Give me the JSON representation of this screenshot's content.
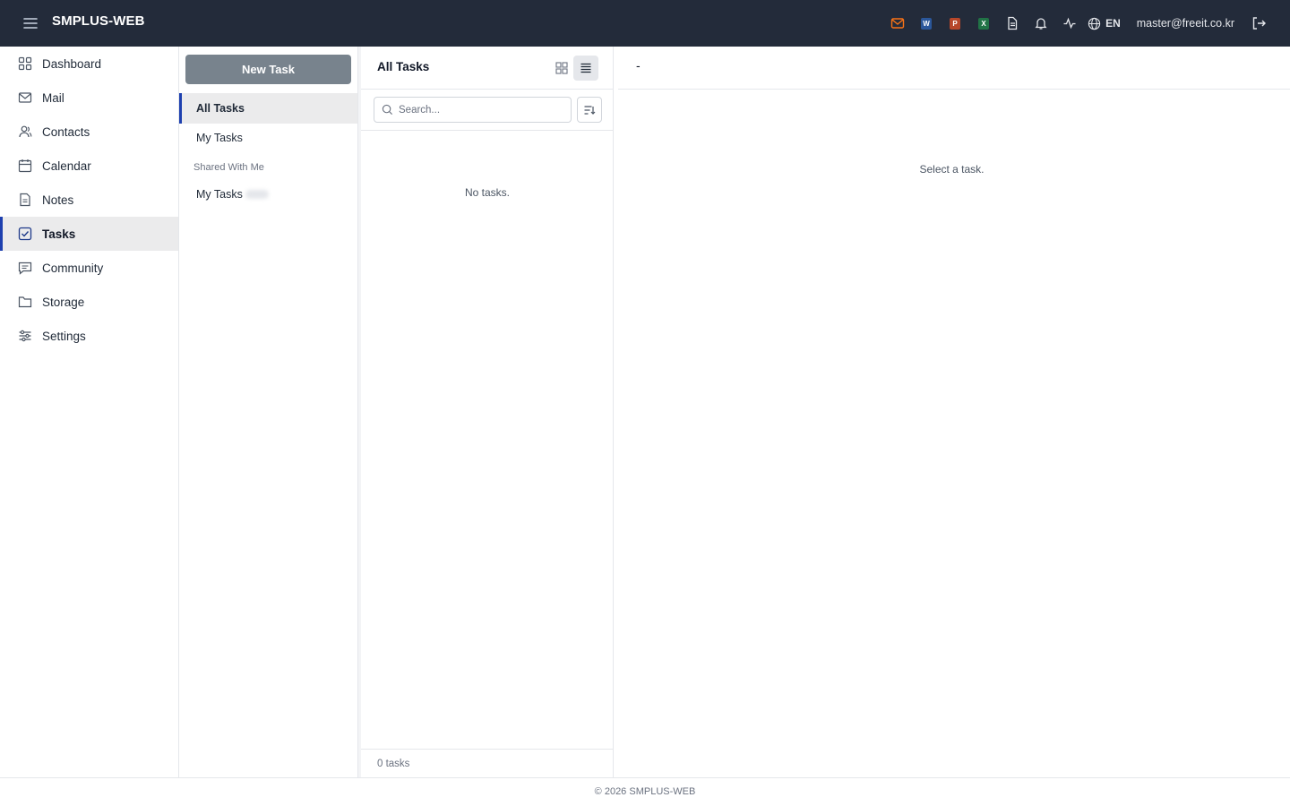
{
  "app": {
    "brand": "SMPLUS-WEB",
    "accent_color": "#1e40af",
    "topbar_color": "#232b3a"
  },
  "topbar": {
    "icons": [
      "mail-icon",
      "word-icon",
      "powerpoint-icon",
      "excel-icon",
      "document-icon",
      "bell-icon",
      "activity-icon",
      "globe-icon"
    ],
    "word_badge": "W",
    "ppt_badge": "P",
    "excel_badge": "X",
    "language": "EN",
    "user_email": "master@freeit.co.kr"
  },
  "sidebar": {
    "items": [
      {
        "label": "Dashboard",
        "icon": "grid-icon"
      },
      {
        "label": "Mail",
        "icon": "mail-icon"
      },
      {
        "label": "Contacts",
        "icon": "contacts-icon"
      },
      {
        "label": "Calendar",
        "icon": "calendar-icon"
      },
      {
        "label": "Notes",
        "icon": "notes-icon"
      },
      {
        "label": "Tasks",
        "icon": "tasks-icon",
        "active": true
      },
      {
        "label": "Community",
        "icon": "chat-icon"
      },
      {
        "label": "Storage",
        "icon": "folder-icon"
      },
      {
        "label": "Settings",
        "icon": "sliders-icon"
      }
    ]
  },
  "folders": {
    "new_task_label": "New Task",
    "all_tasks": "All Tasks",
    "my_tasks": "My Tasks",
    "shared_label": "Shared With Me",
    "shared_my_tasks": "My Tasks"
  },
  "task_list": {
    "title": "All Tasks",
    "search_placeholder": "Search...",
    "empty_text": "No tasks.",
    "count_text": "0 tasks"
  },
  "detail": {
    "title": "-",
    "empty_text": "Select a task."
  },
  "footer": {
    "copyright": "© 2026 SMPLUS-WEB"
  }
}
